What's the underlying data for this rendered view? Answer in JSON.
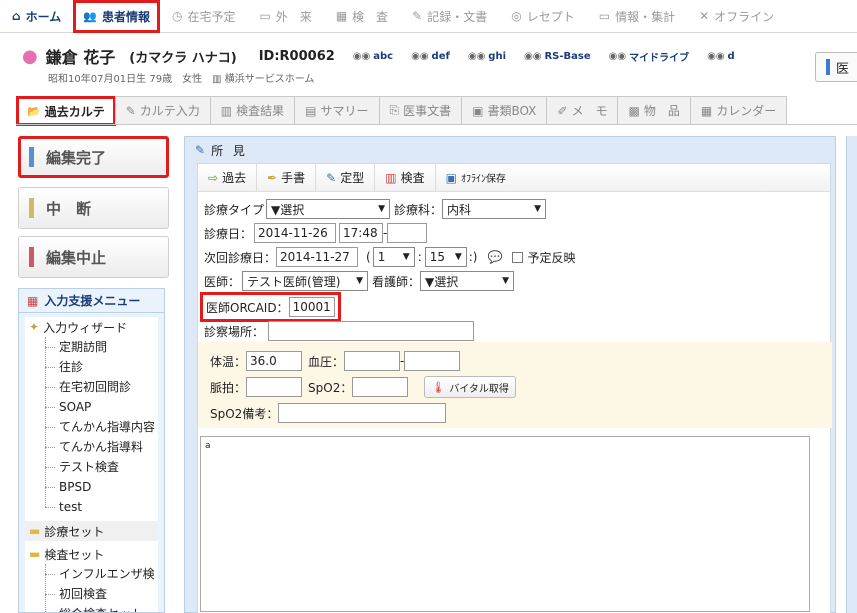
{
  "nav": [
    {
      "label": "ホーム",
      "icon": "home-icon",
      "glyph": "⌂"
    },
    {
      "label": "患者情報",
      "icon": "patients-icon",
      "glyph": "👥"
    },
    {
      "label": "在宅予定",
      "icon": "clock-icon",
      "glyph": "◷"
    },
    {
      "label": "外　来",
      "icon": "outpatient-icon",
      "glyph": "▭"
    },
    {
      "label": "検　査",
      "icon": "exam-icon",
      "glyph": "▦"
    },
    {
      "label": "記録・文書",
      "icon": "document-icon",
      "glyph": "✎"
    },
    {
      "label": "レセプト",
      "icon": "receipt-icon",
      "glyph": "◎"
    },
    {
      "label": "情報・集計",
      "icon": "monitor-icon",
      "glyph": "▭"
    },
    {
      "label": "オフライン",
      "icon": "offline-icon",
      "glyph": "✕"
    }
  ],
  "patient": {
    "name": "鎌倉 花子",
    "kana": "(カマクラ ハナコ)",
    "id": "ID:R00062",
    "links": [
      "abc",
      "def",
      "ghi",
      "RS-Base",
      "マイドライブ",
      "d"
    ],
    "dob": "昭和10年07月01日生 79歳",
    "sex": "女性",
    "facility": "横浜サービスホーム",
    "side_button": "医"
  },
  "tabs": [
    {
      "label": "過去カルテ",
      "icon": "folder-icon",
      "glyph": "📂"
    },
    {
      "label": "カルテ入力",
      "icon": "edit-icon",
      "glyph": "✎"
    },
    {
      "label": "検査結果",
      "icon": "chart-icon",
      "glyph": "▥"
    },
    {
      "label": "サマリー",
      "icon": "summary-icon",
      "glyph": "▤"
    },
    {
      "label": "医事文書",
      "icon": "pdf-icon",
      "glyph": "⎘"
    },
    {
      "label": "書類BOX",
      "icon": "box-icon",
      "glyph": "▣"
    },
    {
      "label": "メ　モ",
      "icon": "pencil-icon",
      "glyph": "✐"
    },
    {
      "label": "物　品",
      "icon": "goods-icon",
      "glyph": "▩"
    },
    {
      "label": "カレンダー",
      "icon": "calendar-icon",
      "glyph": "▦"
    }
  ],
  "actions": {
    "complete": "編集完了",
    "suspend": "中　断",
    "cancel": "編集中止",
    "colors": {
      "complete": "#5b8fd0",
      "suspend": "#c8c060",
      "cancel": "#c85a6e"
    }
  },
  "menu": {
    "title": "入力支援メニュー",
    "wizard": "入力ウィザード",
    "wizard_items": [
      "定期訪問",
      "往診",
      "在宅初回問診",
      "SOAP",
      "てんかん指導内容",
      "てんかん指導料",
      "テスト検査",
      "BPSD",
      "test"
    ],
    "set1": "診療セット",
    "set2": "検査セット",
    "set2_items": [
      "インフルエンザ検",
      "初回検査",
      "総合検査セット"
    ]
  },
  "panel": {
    "title": "所 見",
    "toolbar": [
      "過去",
      "手書",
      "定型",
      "検査",
      "ｵﾌﾗｲﾝ保存"
    ],
    "form": {
      "type_label": "診療タイプ",
      "type_value": "▼選択",
      "dept_label": "診療科：",
      "dept_value": "内科",
      "date_label": "診療日：",
      "date_value": "2014-11-26",
      "time_value": "17:48",
      "next_label": "次回診療日：",
      "next_value": "2014-11-27",
      "next_hour": "1",
      "next_min": "15",
      "schedule_label": "予定反映",
      "doctor_label": "医師：",
      "doctor_value": "テスト医師(管理)",
      "nurse_label": "看護師：",
      "nurse_value": "▼選択",
      "orcaid_label": "医師ORCAID：",
      "orcaid_value": "10001",
      "place_label": "診察場所：",
      "temp_label": "体温：",
      "temp_value": "36.0",
      "bp_label": "血圧：",
      "pulse_label": "脈拍：",
      "spo2_label": "SpO2：",
      "vital_button": "バイタル取得",
      "spo2note_label": "SpO2備考：",
      "note_text": "a"
    }
  }
}
